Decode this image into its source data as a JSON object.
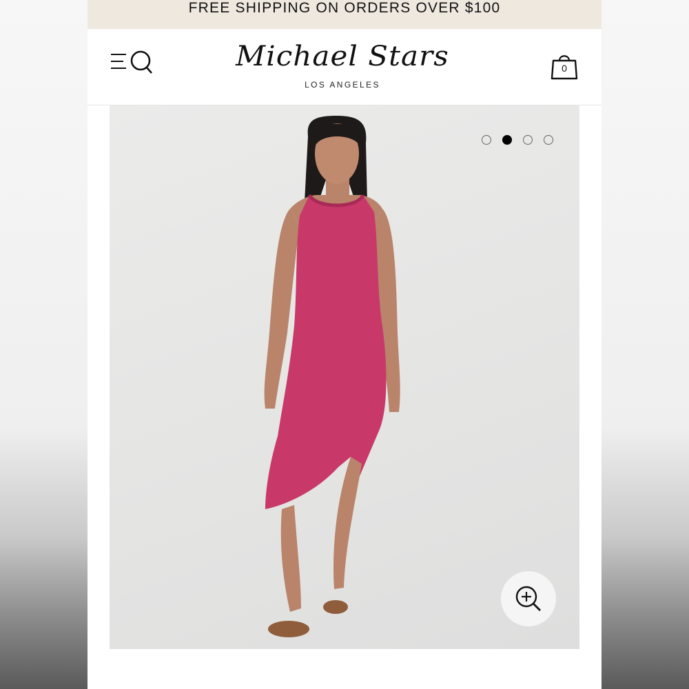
{
  "promo": {
    "text": "FREE SHIPPING ON ORDERS OVER $100"
  },
  "header": {
    "logo_text": "Michael Stars",
    "logo_subtitle": "LOS ANGELES",
    "cart_count": "0"
  },
  "gallery": {
    "slide_count": 4,
    "active_slide": 2,
    "product_color": "#c8396a"
  },
  "icons": {
    "menu": "menu-icon",
    "search": "search-icon",
    "cart": "shopping-bag-icon",
    "zoom": "zoom-in-icon"
  }
}
